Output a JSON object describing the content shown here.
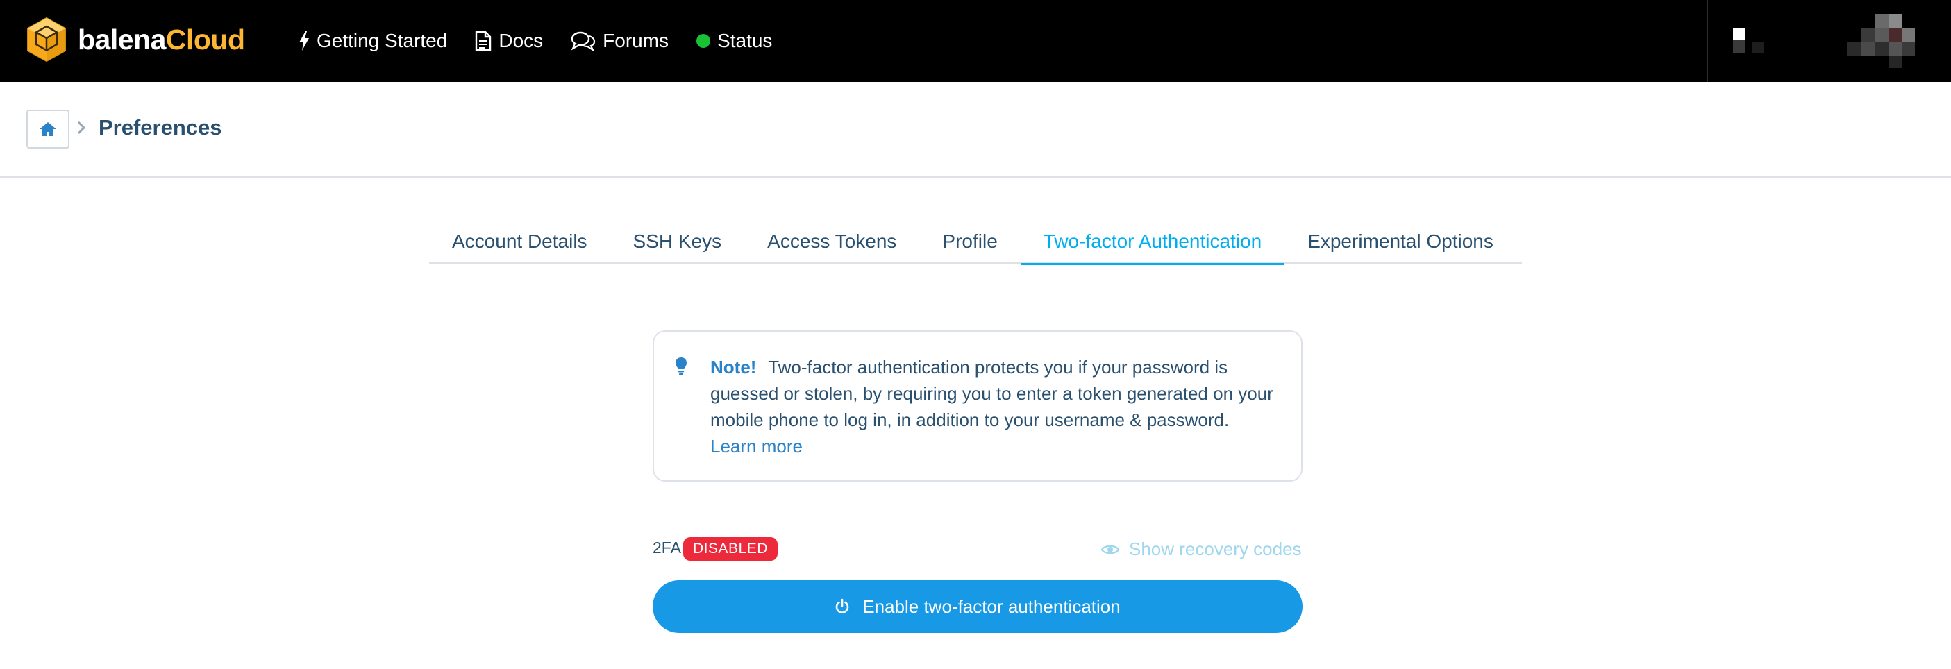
{
  "navbar": {
    "logo": {
      "text_main": "balena",
      "text_accent": "Cloud",
      "icon": "balena-cube-logo",
      "accent_color": "#fcb630"
    },
    "links": [
      {
        "label": "Getting Started",
        "icon": "bolt-icon"
      },
      {
        "label": "Docs",
        "icon": "document-icon"
      },
      {
        "label": "Forums",
        "icon": "chat-bubbles-icon"
      },
      {
        "label": "Status",
        "icon": "status-dot",
        "status_color": "#1ac135"
      }
    ]
  },
  "breadcrumb": {
    "home_icon": "home-icon",
    "current": "Preferences"
  },
  "tabs": [
    {
      "label": "Account Details",
      "active": false
    },
    {
      "label": "SSH Keys",
      "active": false
    },
    {
      "label": "Access Tokens",
      "active": false
    },
    {
      "label": "Profile",
      "active": false
    },
    {
      "label": "Two-factor Authentication",
      "active": true
    },
    {
      "label": "Experimental Options",
      "active": false
    }
  ],
  "note": {
    "icon": "lightbulb-icon",
    "title": "Note!",
    "body": "Two-factor authentication protects you if your password is guessed or stolen, by requiring you to enter a token generated on your mobile phone to log in, in addition to your username & password.",
    "link": "Learn more"
  },
  "two_factor": {
    "label": "2FA",
    "status_badge": "DISABLED",
    "status_color": "#ed2a3b",
    "recovery_link": "Show recovery codes",
    "recovery_icon": "eye-icon",
    "enable_button": "Enable two-factor authentication",
    "enable_icon": "power-icon",
    "button_color": "#1799e6"
  }
}
